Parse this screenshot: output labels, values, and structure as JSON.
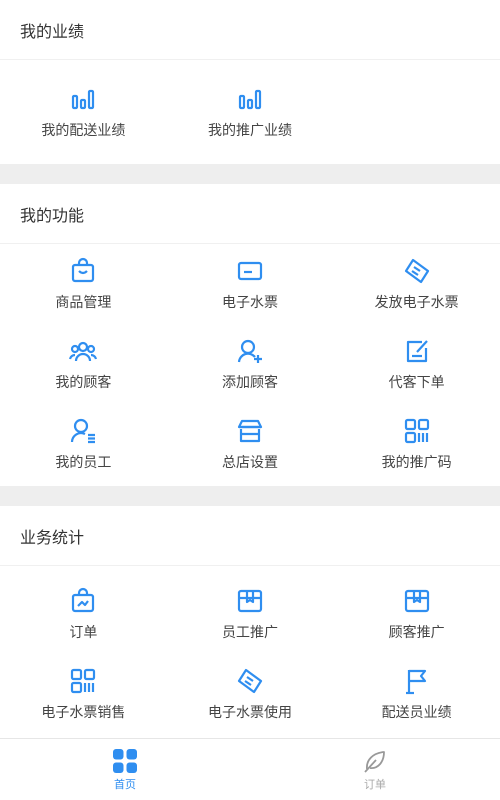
{
  "colors": {
    "accent": "#2f8ef0",
    "divider": "#eeeeee"
  },
  "performance": {
    "title": "我的业绩",
    "items": [
      {
        "label": "我的配送业绩",
        "icon": "bar-chart-icon"
      },
      {
        "label": "我的推广业绩",
        "icon": "bar-chart-icon"
      }
    ]
  },
  "functions": {
    "title": "我的功能",
    "items": [
      {
        "label": "商品管理",
        "icon": "shopping-bag-icon"
      },
      {
        "label": "电子水票",
        "icon": "card-icon"
      },
      {
        "label": "发放电子水票",
        "icon": "ticket-icon"
      },
      {
        "label": "我的顾客",
        "icon": "customers-icon"
      },
      {
        "label": "添加顾客",
        "icon": "add-user-icon"
      },
      {
        "label": "代客下单",
        "icon": "edit-order-icon"
      },
      {
        "label": "我的员工",
        "icon": "employee-icon"
      },
      {
        "label": "总店设置",
        "icon": "store-icon"
      },
      {
        "label": "我的推广码",
        "icon": "qr-code-icon"
      }
    ]
  },
  "statistics": {
    "title": "业务统计",
    "items": [
      {
        "label": "订单",
        "icon": "order-bag-icon"
      },
      {
        "label": "员工推广",
        "icon": "box-icon"
      },
      {
        "label": "顾客推广",
        "icon": "box-icon"
      },
      {
        "label": "电子水票销售",
        "icon": "qr-code-icon"
      },
      {
        "label": "电子水票使用",
        "icon": "ticket-icon"
      },
      {
        "label": "配送员业绩",
        "icon": "flag-icon"
      }
    ]
  },
  "tabbar": {
    "home_label": "首页",
    "orders_label": "订单"
  }
}
